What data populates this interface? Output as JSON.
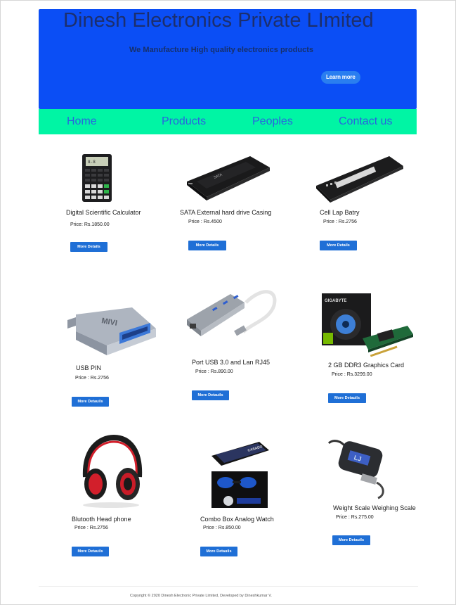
{
  "header": {
    "title": "Dinesh Electronics Private LImited",
    "subtitle": "We Manufacture High quality electronics  products",
    "cta_label": "Learn more"
  },
  "nav": {
    "items": [
      {
        "label": "Home"
      },
      {
        "label": "Products"
      },
      {
        "label": "Peoples"
      },
      {
        "label": "Contact us"
      }
    ]
  },
  "products": [
    {
      "name": "Digital Scientific Calculator",
      "price": "Price: Rs.1850.00",
      "button": "More Details",
      "icon": "calculator-icon"
    },
    {
      "name": "SATA External hard drive Casing",
      "price": "Price : Rs.4500",
      "button": "More Details",
      "icon": "hard-drive-icon"
    },
    {
      "name": "Cell Lap Batry",
      "price": "Price : Rs.2756",
      "button": "More Details",
      "icon": "battery-icon"
    },
    {
      "name": "USB PIN",
      "price": "Price : Rs.2756",
      "button": "More Detauils",
      "icon": "usb-adapter-icon"
    },
    {
      "name": "Port USB 3.0 and Lan RJ45",
      "price": "Price : Rs.890.00",
      "button": "More Detauils",
      "icon": "usb-hub-icon"
    },
    {
      "name": "2 GB DDR3 Graphics Card",
      "price": "Price : Rs.3299.00",
      "button": "More Detauils",
      "icon": "graphics-card-icon"
    },
    {
      "name": "Blutooth Head phone",
      "price": "Price : Rs.2756",
      "button": "More Detauils",
      "icon": "headphones-icon"
    },
    {
      "name": "Combo Box Analog Watch",
      "price": "Price : Rs.850.00",
      "button": "More Detauils",
      "icon": "watch-box-icon"
    },
    {
      "name": "Weight Scale Weighing Scale",
      "price": "Price : Rs.275.00",
      "button": "More Detauils",
      "icon": "weighing-scale-icon"
    }
  ],
  "footer": {
    "text": "Copyright © 2020 Dinesh Electronic Private Limited, Developed by Dineshkumar V."
  },
  "colors": {
    "hero_bg": "#0b4ef5",
    "nav_bg": "#00f5a4",
    "button_bg": "#1f6fd6"
  }
}
